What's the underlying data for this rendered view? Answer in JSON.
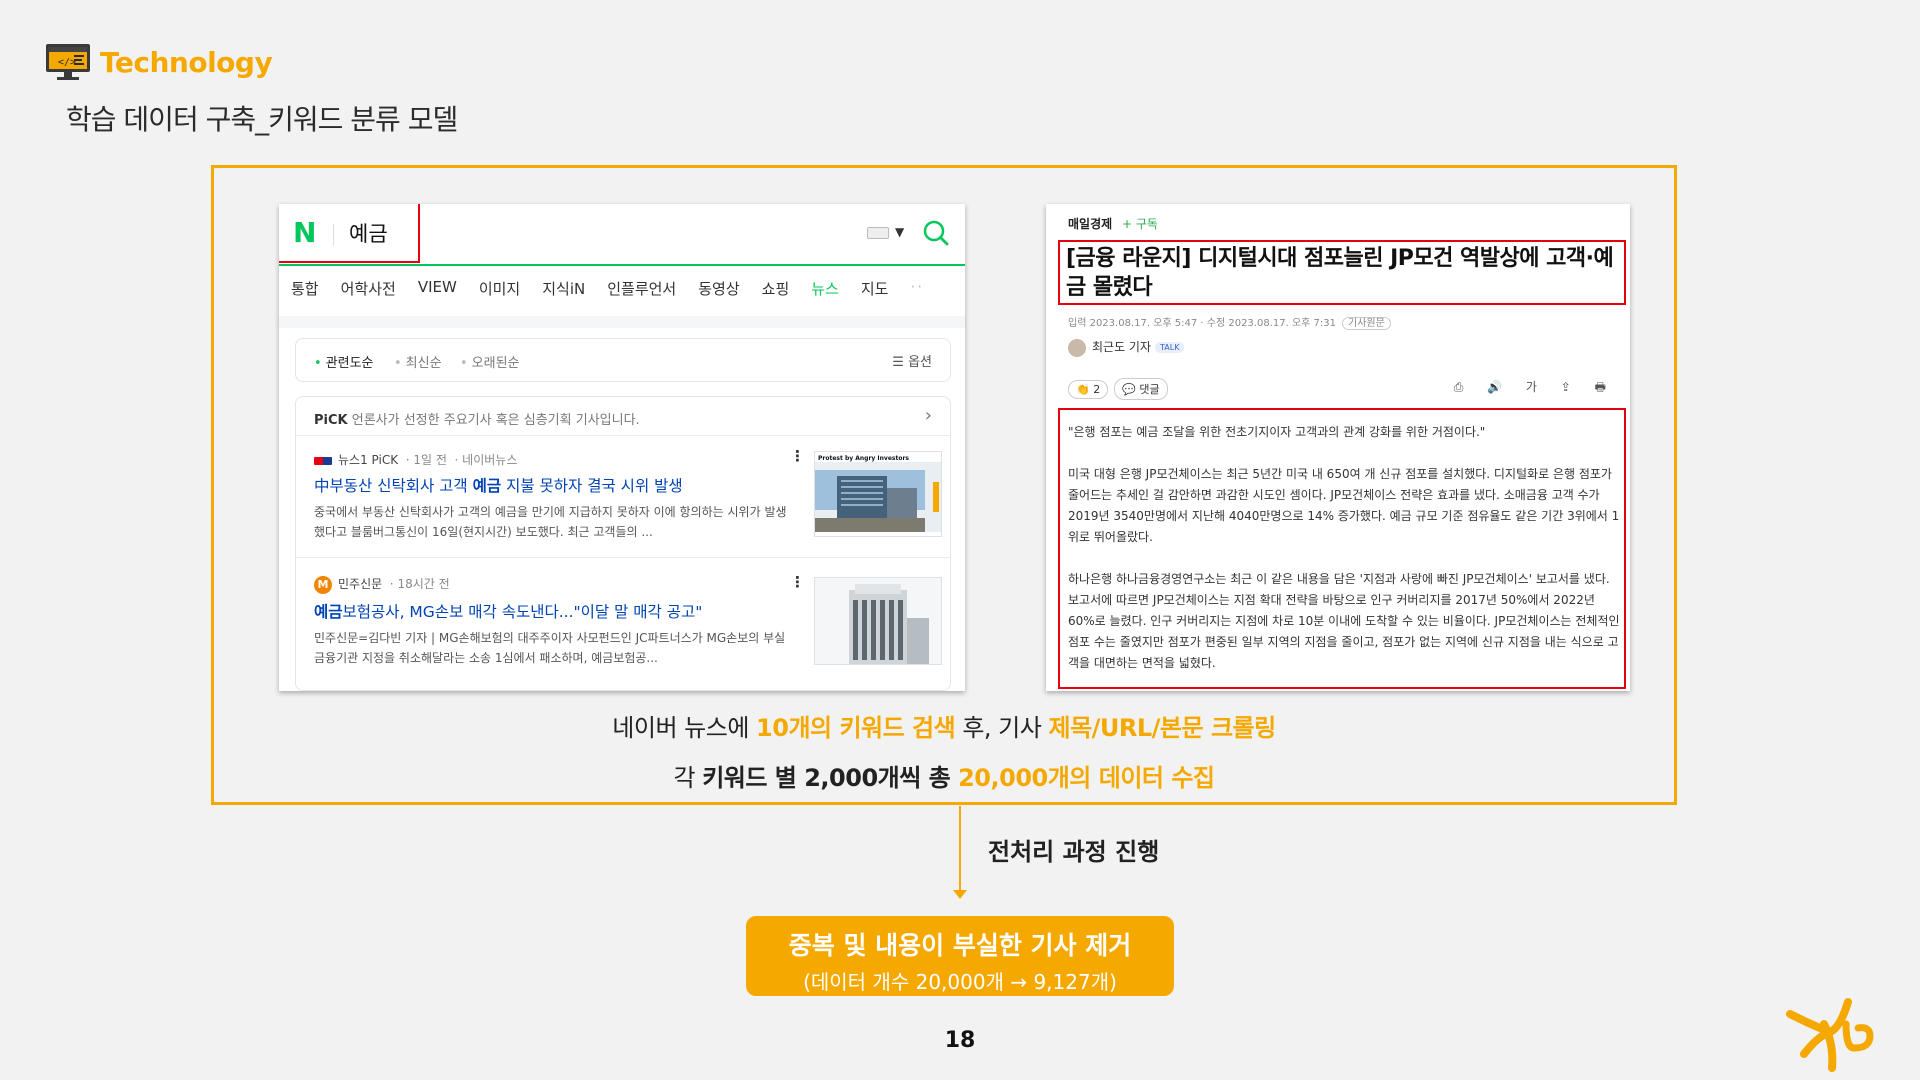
{
  "header": {
    "tag": "Technology",
    "title": "학습 데이터 구축_키워드 분류 모델"
  },
  "naver": {
    "logo": "N",
    "query": "예금",
    "tabs": [
      "통합",
      "어학사전",
      "VIEW",
      "이미지",
      "지식iN",
      "인플루언서",
      "동영상",
      "쇼핑",
      "뉴스",
      "지도"
    ],
    "active_tab": "뉴스",
    "more": "··",
    "sort": [
      "관련도순",
      "최신순",
      "오래된순"
    ],
    "options": "☰ 옵션",
    "pick_label": "PiCK",
    "pick_text": "언론사가 선정한 주요기사 혹은 심층기획 기사입니다.",
    "items": [
      {
        "source": "뉴스1 PiCK",
        "time": "1일 전",
        "extra": "네이버뉴스",
        "headline_pre": "中부동산 신탁회사 고객 ",
        "headline_kw": "예금",
        "headline_post": " 지불 못하자 결국 시위 발생",
        "desc": "중국에서 부동산 신탁회사가 고객의 예금을 만기에 지급하지 못하자 이에 항의하는 시위가 발생했다고 블룸버그통신이 16일(현지시간) 보도했다. 최근 고객들의 ...",
        "thumb_text": "Protest by Angry Investors"
      },
      {
        "source": "민주신문",
        "time": "18시간 전",
        "headline_kw": "예금",
        "headline_post": "보험공사, MG손보 매각 속도낸다...\"이달 말 매각 공고\"",
        "desc": "민주신문=김다빈 기자 | MG손해보험의 대주주이자 사모펀드인 JC파트너스가 MG손보의 부실금융기관 지정을 취소해달라는 소송 1심에서 패소하며, 예금보험공..."
      }
    ]
  },
  "article": {
    "paper": "매일경제",
    "subscribe": "+ 구독",
    "title": "[금융 라운지] 디지털시대 점포늘린 JP모건 역발상에 고객·예금 몰렸다",
    "date": "입력 2023.08.17. 오후 5:47 · 수정 2023.08.17. 오후 7:31",
    "original": "기사원문",
    "reporter": "최근도 기자",
    "talk": "TALK",
    "reactions": [
      "👏 2",
      "💬 댓글"
    ],
    "tools": "⎙ 🔊 가 ⇪ 🖶",
    "paragraphs": [
      "\"은행 점포는 예금 조달을 위한 전초기지이자 고객과의 관계 강화를 위한 거점이다.\"",
      "미국 대형 은행 JP모건체이스는 최근 5년간 미국 내 650여 개 신규 점포를 설치했다. 디지털화로 은행 점포가 줄어드는 추세인 걸 감안하면 과감한 시도인 셈이다. JP모건체이스 전략은 효과를 냈다. 소매금융 고객 수가 2019년 3540만명에서 지난해 4040만명으로 14% 증가했다. 예금 규모 기준 점유율도 같은 기간 3위에서 1위로 뛰어올랐다.",
      "하나은행 하나금융경영연구소는 최근 이 같은 내용을 담은 '지점과 사랑에 빠진 JP모건체이스' 보고서를 냈다. 보고서에 따르면 JP모건체이스는 지점 확대 전략을 바탕으로 인구 커버리지를 2017년 50%에서 2022년 60%로 늘렸다. 인구 커버리지는 지점에 차로 10분 이내에 도착할 수 있는 비율이다. JP모건체이스는 전체적인 점포 수는 줄였지만 점포가 편중된 일부 지역의 지점을 줄이고, 점포가 없는 지역에 신규 지점을 내는 식으로 고객을 대면하는 면적을 넓혔다."
    ]
  },
  "captions": {
    "line1": [
      "네이버 뉴스에 ",
      "10개의 키워드 검색",
      " 후, 기사 ",
      "제목/URL/본문 크롤링"
    ],
    "line2": [
      "각 ",
      "키워드 별 2,000개씩 총 ",
      "20,000개의 데이터 수집"
    ]
  },
  "flow": {
    "label": "전처리 과정 진행",
    "result_title": "중복 및 내용이 부실한 기사 제거",
    "result_sub": "(데이터 개수 20,000개 → 9,127개)"
  },
  "page_number": "18",
  "colors": {
    "accent": "#f5a800",
    "naver_green": "#03c75a",
    "highlight_red": "#e60012",
    "link_blue": "#0043b3"
  }
}
